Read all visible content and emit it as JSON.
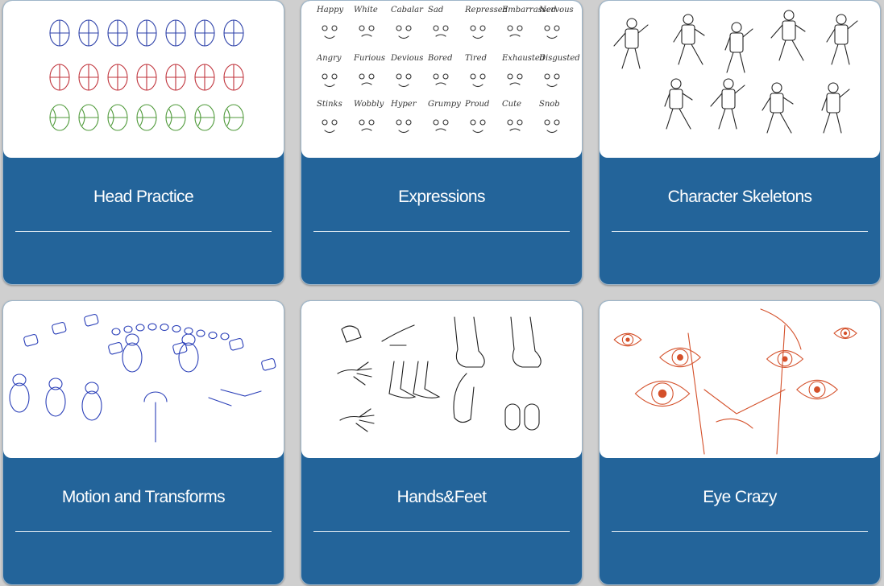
{
  "gallery": {
    "cards": [
      {
        "title": "Head Practice",
        "sketch_color": "#2b3fa8",
        "thumbnail": "sketch of head construction studies in blue, red and green"
      },
      {
        "title": "Expressions",
        "sketch_color": "#333333",
        "thumbnail": "sketch sheet of cartoon facial expressions",
        "captions": [
          "Happy",
          "White",
          "Cabalar",
          "Sad",
          "Repressed",
          "Embarrassed",
          "Nervous",
          "Angry",
          "Furious",
          "Devious",
          "Bored",
          "Tired",
          "Exhausted",
          "Disgusted",
          "Stinks",
          "Wobbly",
          "Hyper",
          "Grumpy",
          "Proud",
          "Cute",
          "Snob"
        ]
      },
      {
        "title": "Character Skeletons",
        "sketch_color": "#222222",
        "thumbnail": "sketch of mannequin skeletons in action poses"
      },
      {
        "title": "Motion and Transforms",
        "sketch_color": "#2a3fb8",
        "thumbnail": "blue sketches of shapes in motion and transformation"
      },
      {
        "title": "Hands&Feet",
        "sketch_color": "#1e1e1e",
        "thumbnail": "sketch of hands and feet studies"
      },
      {
        "title": "Eye Crazy",
        "sketch_color": "#d4502a",
        "thumbnail": "orange sketches of eyes and faces"
      }
    ]
  }
}
